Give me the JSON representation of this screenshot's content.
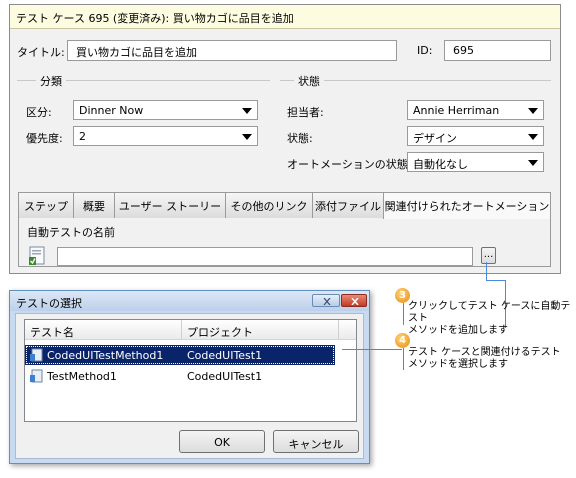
{
  "form": {
    "window_title": "テスト ケース 695 (変更済み): 買い物カゴに品目を追加",
    "title_label": "タイトル:",
    "title_value": "買い物カゴに品目を追加",
    "id_label": "ID:",
    "id_value": "695",
    "classification": {
      "heading": "分類",
      "area_label": "区分:",
      "area_value": "Dinner Now",
      "priority_label": "優先度:",
      "priority_value": "2"
    },
    "status": {
      "heading": "状態",
      "assigned_label": "担当者:",
      "assigned_value": "Annie Herriman",
      "state_label": "状態:",
      "state_value": "デザイン",
      "automation_label": "オートメーションの状態:",
      "automation_value": "自動化なし"
    },
    "tabs": [
      {
        "label": "ステップ"
      },
      {
        "label": "概要"
      },
      {
        "label": "ユーザー ストーリー"
      },
      {
        "label": "その他のリンク"
      },
      {
        "label": "添付ファイル"
      },
      {
        "label": "関連付けられたオートメーション"
      }
    ],
    "automated_test_name_label": "自動テストの名前",
    "automated_test_name_value": "",
    "browse_button_label": "..."
  },
  "dialog": {
    "title": "テストの選択",
    "columns": [
      "テスト名",
      "プロジェクト"
    ],
    "rows": [
      {
        "name": "CodedUITestMethod1",
        "project": "CodedUITest1",
        "selected": true
      },
      {
        "name": "TestMethod1",
        "project": "CodedUITest1",
        "selected": false
      }
    ],
    "ok_label": "OK",
    "cancel_label": "キャンセル"
  },
  "callouts": [
    {
      "number": "3",
      "line1": "クリックしてテスト ケースに自動テスト",
      "line2": "メソッドを追加します"
    },
    {
      "number": "4",
      "line1": "テスト ケースと関連付けるテスト",
      "line2": "メソッドを選択します"
    }
  ],
  "colors": {
    "selection": "#0a246a",
    "callout_line": "#4a8ad8",
    "callout_badge": "#e88a0c",
    "form_title_bg": "#fdfbe0"
  }
}
